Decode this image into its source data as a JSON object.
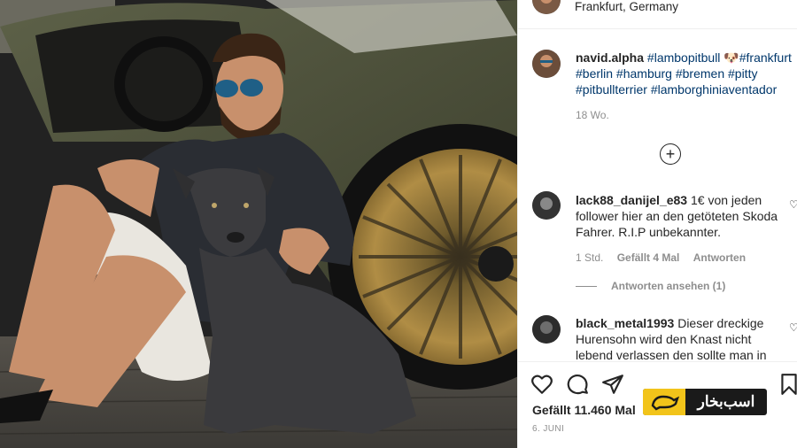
{
  "post": {
    "location": "Frankfurt, Germany",
    "caption": {
      "username": "navid.alpha",
      "tags_line1": "#lambopitbull 🐶#frankfurt",
      "line2": "#berlin #hamburg #bremen #pitty",
      "line3": "#pitbullterrier #lamborghiniaventador",
      "time": "18 Wo."
    },
    "load_more_icon": "plus-circle-icon",
    "comments": [
      {
        "username": "lack88_danijel_e83",
        "text": "1€ von jeden follower hier an den getöteten Skoda Fahrer. R.I.P unbekannter.",
        "time": "1 Std.",
        "likes": "Gefällt 4 Mal",
        "reply": "Antworten",
        "view_replies": "Antworten ansehen (1)"
      },
      {
        "username": "black_metal1993",
        "text": "Dieser dreckige Hurensohn wird den Knast nicht lebend verlassen den sollte man in"
      }
    ],
    "likes_text": "Gefällt 11.460 Mal",
    "date": "6. JUNI"
  },
  "logo": {
    "text": "اسب‌بخار",
    "accent": "#f2c41a"
  },
  "colors": {
    "tag": "#00376b",
    "meta": "#8e8e8e",
    "text": "#262626"
  }
}
